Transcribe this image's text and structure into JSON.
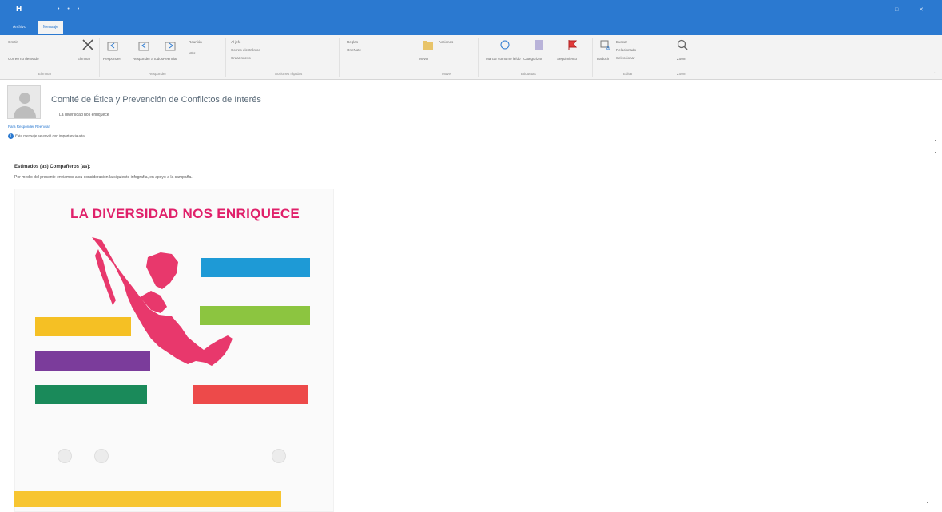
{
  "window": {
    "app_icon_letter": "H",
    "quick_access": "• • •",
    "title": "",
    "controls": [
      "—",
      "□",
      "✕"
    ]
  },
  "tabs": [
    {
      "label": "Archivo"
    },
    {
      "label": "Mensaje",
      "active": true
    },
    {
      "label": ""
    }
  ],
  "ribbon": {
    "groups": [
      {
        "label": "Eliminar"
      },
      {
        "label": "Responder"
      },
      {
        "label": "Acciones rápidas"
      },
      {
        "label": "Mover"
      },
      {
        "label": "Etiquetas"
      },
      {
        "label": "Editar"
      },
      {
        "label": "Zoom"
      }
    ],
    "buttons": {
      "ignore": "Omitir",
      "junk": "Correo no deseado",
      "delete": "Eliminar",
      "reply": "Responder",
      "reply_all": "Responder a todos",
      "forward": "Reenviar",
      "im": "Reunión",
      "more": "Más",
      "to_manager": "Al jefe",
      "team_email": "Correo electrónico",
      "create_new": "Crear nuevo",
      "move": "Mover",
      "rules": "Reglas",
      "onenote": "OneNote",
      "actions": "Acciones",
      "mark_unread": "Marcar como no leído",
      "categorize": "Categorizar",
      "follow_up": "Seguimiento",
      "translate": "Traducir",
      "find": "Buscar",
      "related": "Relacionado",
      "select": "Seleccionar",
      "zoom": "Zoom"
    }
  },
  "message": {
    "sender": "",
    "subject": "Comité de Ética y Prevención de Conflictos de Interés",
    "to": "La diversidad nos enriquece",
    "actions": "Para  Responder  Reenviar",
    "info": "Este mensaje se envió con importancia alta.",
    "greeting": "Estimados (as) Compañeros (as):",
    "body": "Por medio del presente enviamos a su consideración la siguiente infografía, en apoyo a la campaña."
  },
  "infographic": {
    "title": "LA DIVERSIDAD NOS ENRIQUECE",
    "subtitle": "",
    "banners": [
      {
        "key": "blue",
        "bold": "",
        "text": ""
      },
      {
        "key": "green",
        "bold": "",
        "text": ""
      },
      {
        "key": "yellow",
        "bold": "",
        "text": ""
      },
      {
        "key": "purple",
        "bold": "",
        "text": ""
      },
      {
        "key": "teal",
        "bold": "",
        "text": ""
      },
      {
        "key": "red",
        "bold": "",
        "text": ""
      }
    ],
    "footer": "",
    "bottom_bar": ""
  },
  "colors": {
    "title_bar": "#2b79d0",
    "ribbon_bg": "#f3f3f3",
    "infographic_title": "#e0206a",
    "map": "#e8386c",
    "banner_blue": "#1e9ad6",
    "banner_green": "#8cc540",
    "banner_yellow": "#f5c024",
    "banner_purple": "#7b3c9b",
    "banner_teal": "#1a8a5a",
    "banner_red": "#ed4a4a",
    "bottom_bar": "#f7c531"
  }
}
